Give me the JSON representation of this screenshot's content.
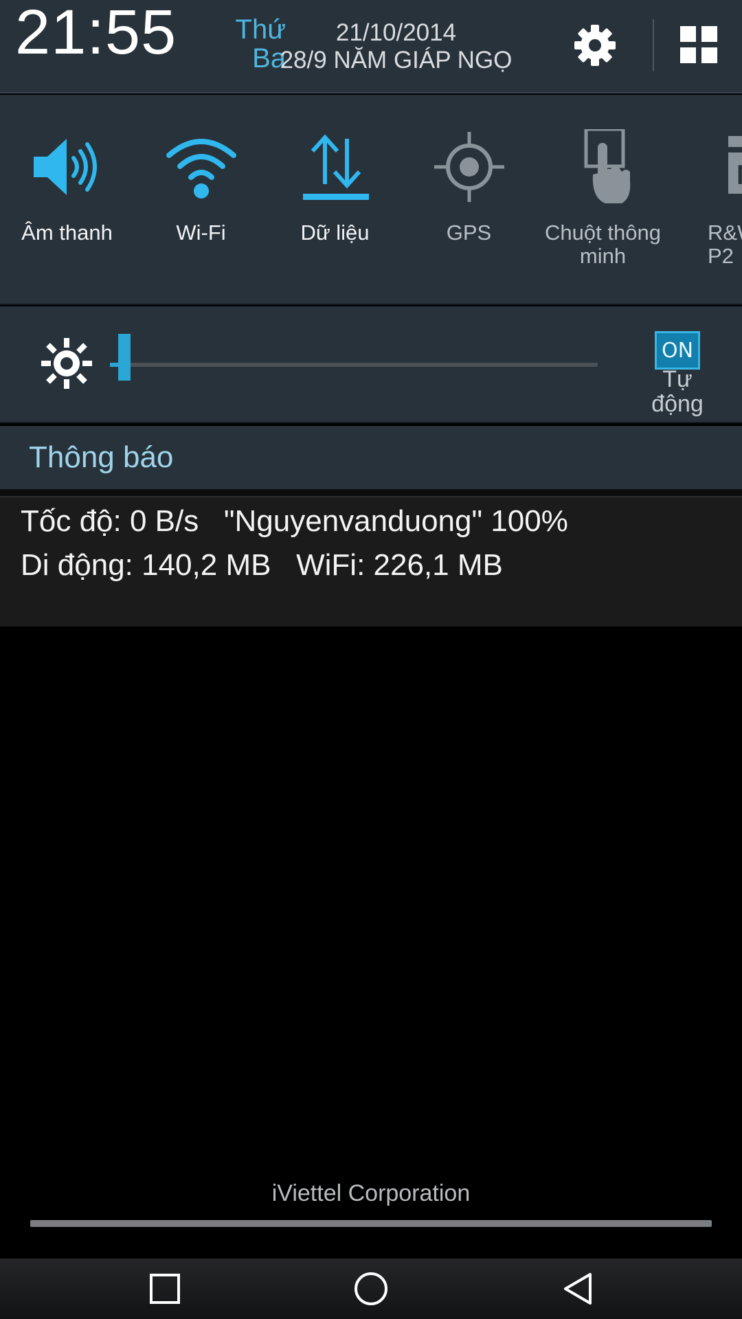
{
  "header": {
    "time": "21:55",
    "weekday_line1": "Thứ",
    "weekday_line2": "Ba",
    "date": "21/10/2014",
    "lunar_date": "28/9 NĂM GIÁP NGỌ",
    "settings_icon": "gear-icon",
    "grid_icon": "grid-icon"
  },
  "toggles": [
    {
      "label": "Âm thanh",
      "icon": "speaker-icon",
      "active": true
    },
    {
      "label": "Wi-Fi",
      "icon": "wifi-icon",
      "active": true
    },
    {
      "label": "Dữ liệu",
      "icon": "data-arrows-icon",
      "active": true
    },
    {
      "label": "GPS",
      "icon": "gps-icon",
      "active": false
    },
    {
      "label_line1": "Chuột thông",
      "label_line2": "minh",
      "icon": "smart-touch-icon",
      "active": false
    },
    {
      "label_line1": "R&W",
      "label_line2": "P2",
      "icon": "nfc-icon",
      "active": false
    }
  ],
  "brightness": {
    "level_percent": 3,
    "auto_badge": "ON",
    "auto_label_line1": "Tự",
    "auto_label_line2": "động"
  },
  "notifications": {
    "title": "Thông báo",
    "network": {
      "line1": "Tốc độ: 0 B/s   \"Nguyenvanduong\" 100%",
      "line2": "Di động: 140,2 MB   WiFi: 226,1 MB"
    }
  },
  "carrier": "iViettel Corporation",
  "colors": {
    "accent": "#2ba7d6",
    "panel": "#28323b",
    "inactive_icon": "#8a9399"
  }
}
